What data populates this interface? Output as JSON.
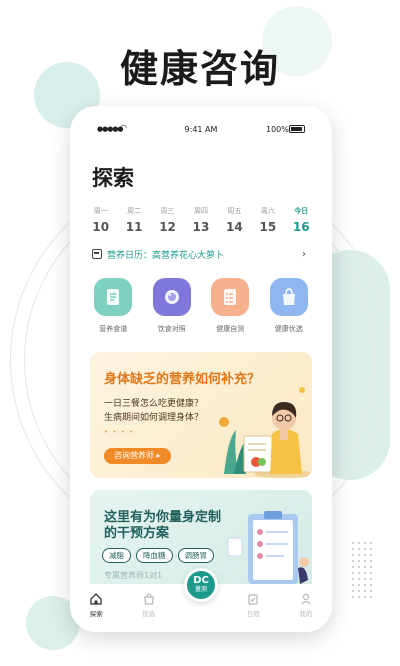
{
  "hero": {
    "title": "健康咨询"
  },
  "status_bar": {
    "time": "9:41 AM",
    "battery": "100%"
  },
  "page": {
    "title": "探索"
  },
  "week": [
    {
      "label": "周一",
      "num": "10"
    },
    {
      "label": "周二",
      "num": "11"
    },
    {
      "label": "周三",
      "num": "12"
    },
    {
      "label": "周四",
      "num": "13"
    },
    {
      "label": "周五",
      "num": "14"
    },
    {
      "label": "周六",
      "num": "15"
    },
    {
      "label": "今日",
      "num": "16"
    }
  ],
  "diary": {
    "text": "营养日历：高营养花心大萝卜"
  },
  "features": [
    {
      "label": "营养食谱",
      "icon": "recipe-icon",
      "color": "#7ed0bf"
    },
    {
      "label": "饮食对照",
      "icon": "plate-icon",
      "color": "#7f77d9"
    },
    {
      "label": "健康自测",
      "icon": "checklist-icon",
      "color": "#f6b08e"
    },
    {
      "label": "健康优选",
      "icon": "bag-icon",
      "color": "#8fb6ef"
    }
  ],
  "banner1": {
    "title": "身体缺乏的营养如何补充？",
    "line1": "一日三餐怎么吃更健康？",
    "line2": "生病期间如何调理身体？",
    "button": "咨询营养师 ▸"
  },
  "banner2": {
    "title1": "这里有为你量身定制",
    "title2": "的干预方案",
    "tags": [
      "减脂",
      "降血糖",
      "调肠胃"
    ],
    "sub": "专属营养师1对1"
  },
  "tabbar": {
    "tabs": [
      "探索",
      "优选",
      "日程",
      "我的"
    ],
    "center_logo": "DC",
    "center_label": "量测"
  },
  "colors": {
    "accent": "#1d9a8c",
    "orange": "#ef8a26"
  }
}
